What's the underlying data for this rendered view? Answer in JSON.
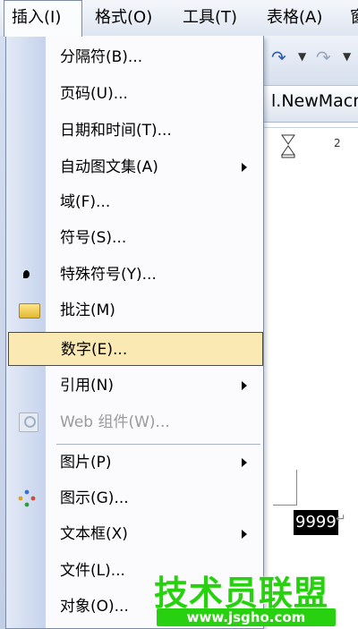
{
  "menubar": {
    "items": [
      {
        "label": "插入(I)",
        "active": true
      },
      {
        "label": "格式(O)"
      },
      {
        "label": "工具(T)"
      },
      {
        "label": "表格(A)"
      },
      {
        "label": "窗"
      }
    ]
  },
  "document": {
    "title_fragment": "l.NewMacr",
    "ruler_mark": "2",
    "selected_text": "9999",
    "para_mark": "↵"
  },
  "dropdown": {
    "items": [
      {
        "label": "分隔符(B)...",
        "submenu": false
      },
      {
        "label": "页码(U)...",
        "submenu": false
      },
      {
        "label": "日期和时间(T)...",
        "submenu": false
      },
      {
        "label": "自动图文集(A)",
        "submenu": true
      },
      {
        "label": "域(F)...",
        "submenu": false
      },
      {
        "label": "符号(S)...",
        "submenu": false
      },
      {
        "label": "特殊符号(Y)...",
        "submenu": false,
        "icon": "bullet-icon"
      },
      {
        "label": "批注(M)",
        "submenu": false,
        "icon": "folder-icon"
      },
      {
        "label": "数字(E)...",
        "submenu": false,
        "highlighted": true
      },
      {
        "label": "引用(N)",
        "submenu": true
      },
      {
        "label": "Web 组件(W)...",
        "submenu": false,
        "disabled": true,
        "icon": "web-component-icon"
      },
      {
        "label": "图片(P)",
        "submenu": true
      },
      {
        "label": "图示(G)...",
        "submenu": false,
        "icon": "diagram-icon"
      },
      {
        "label": "文本框(X)",
        "submenu": true
      },
      {
        "label": "文件(L)...",
        "submenu": false
      },
      {
        "label": "对象(O)...",
        "submenu": false
      }
    ]
  },
  "watermark": {
    "name": "技术员联盟",
    "url": "www.jsgho.com"
  },
  "colors": {
    "highlight": "#fbe9b4",
    "watermark_green": "#28d10f"
  }
}
